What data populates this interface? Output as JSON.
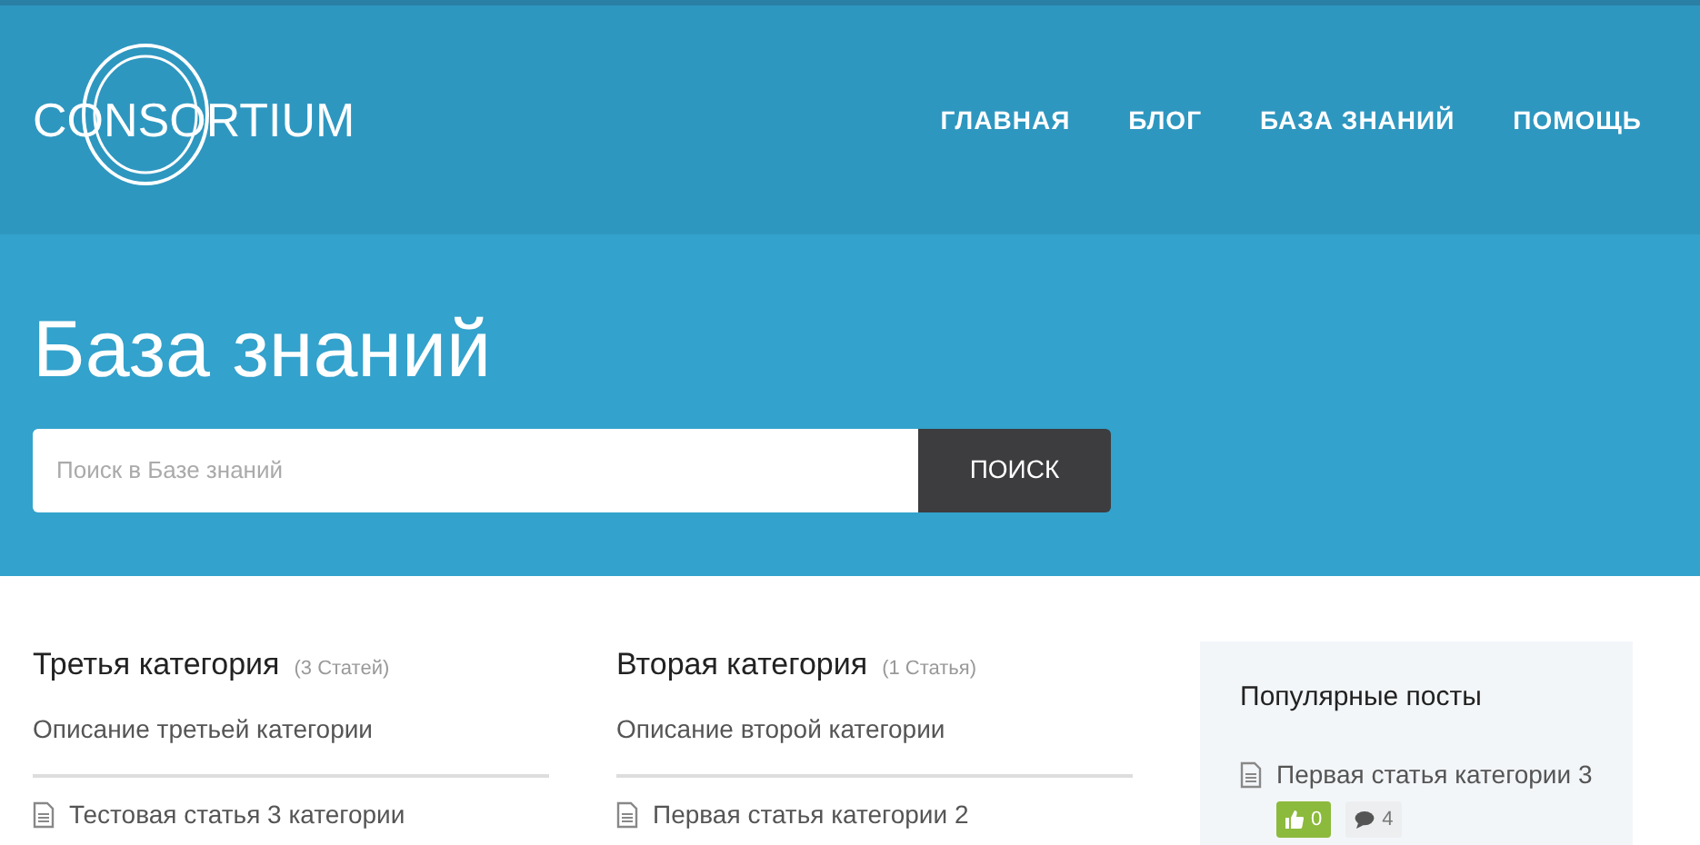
{
  "logo": {
    "text": "CONSORTIUM"
  },
  "nav": [
    "ГЛАВНАЯ",
    "БЛОГ",
    "БАЗА ЗНАНИЙ",
    "ПОМОЩЬ"
  ],
  "hero": {
    "title": "База знаний",
    "search": {
      "placeholder": "Поиск в Базе знаний",
      "button": "ПОИСК"
    }
  },
  "categories": [
    {
      "title": "Третья категория",
      "count": "(3 Статей)",
      "description": "Описание третьей категории",
      "articles": [
        "Тестовая статья 3 категории"
      ]
    },
    {
      "title": "Вторая категория",
      "count": "(1 Статья)",
      "description": "Описание второй категории",
      "articles": [
        "Первая статья категории 2"
      ]
    }
  ],
  "sidebar": {
    "title": "Популярные посты",
    "posts": [
      {
        "title": "Первая статья категории 3",
        "likes": "0",
        "comments": "4"
      }
    ]
  }
}
